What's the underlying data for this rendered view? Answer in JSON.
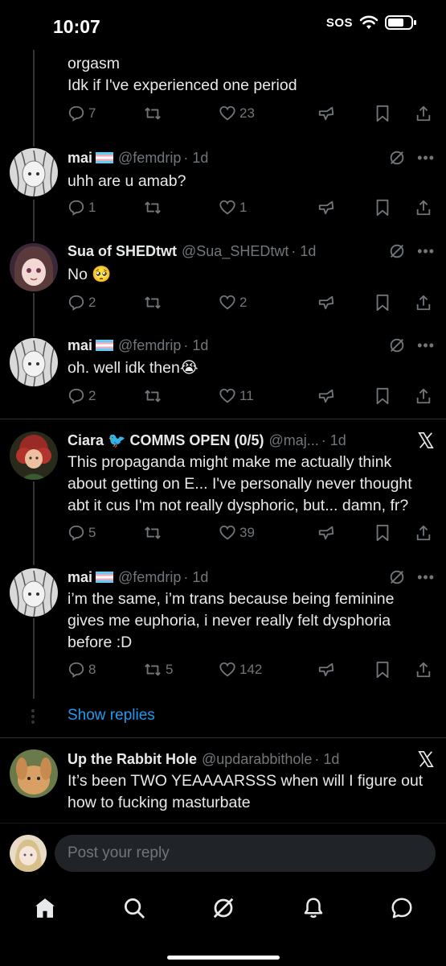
{
  "status_bar": {
    "time": "10:07",
    "sos": "SOS"
  },
  "tweets": [
    {
      "text_line1": "orgasm",
      "text_line2": "Idk if I've experienced one period",
      "replies": "7",
      "retweets": "",
      "likes": "23"
    },
    {
      "name": "mai",
      "handle": "@femdrip",
      "time": "· 1d",
      "text": "uhh are u amab?",
      "replies": "1",
      "retweets": "",
      "likes": "1"
    },
    {
      "name": "Sua of SHEDtwt",
      "handle": "@Sua_SHEDtwt",
      "time": "· 1d",
      "text": "No 🥺",
      "replies": "2",
      "retweets": "",
      "likes": "2"
    },
    {
      "name": "mai",
      "handle": "@femdrip",
      "time": "· 1d",
      "text": "oh. well idk then😭",
      "replies": "2",
      "retweets": "",
      "likes": "11"
    },
    {
      "name": "Ciara 🐦 COMMS OPEN (0/5)",
      "handle": "@maj...",
      "time": "· 1d",
      "text": "This propaganda might make me actually think about getting on E... I've personally never thought abt it cus I'm not really dysphoric, but... damn, fr?",
      "replies": "5",
      "retweets": "",
      "likes": "39"
    },
    {
      "name": "mai",
      "handle": "@femdrip",
      "time": "· 1d",
      "text": "i’m the same, i’m trans because being feminine gives me euphoria, i never really felt dysphoria before :D",
      "replies": "8",
      "retweets": "5",
      "likes": "142"
    },
    {
      "name": "Up the Rabbit Hole",
      "handle": "@updarabbithole",
      "time": "· 1d",
      "text": "It’s been TWO YEAAAARSSS when will I figure out how to fucking masturbate"
    }
  ],
  "show_replies": "Show replies",
  "reply_bar": {
    "placeholder": "Post your reply"
  },
  "colors": {
    "background": "#000000",
    "accent": "#1d9bf0",
    "muted": "#71767b",
    "text": "#e7e9ea"
  },
  "icons": [
    "reply-icon",
    "retweet-icon",
    "like-icon",
    "views-icon",
    "bookmark-icon",
    "share-icon",
    "grok-icon",
    "x-logo-icon",
    "home-icon",
    "search-icon",
    "notifications-icon",
    "messages-icon"
  ]
}
